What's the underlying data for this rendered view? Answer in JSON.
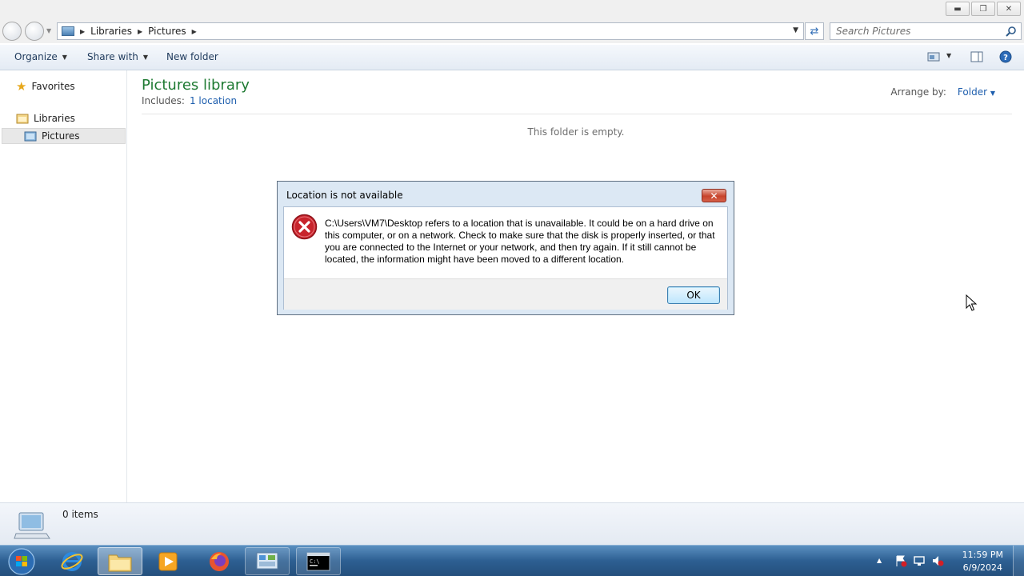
{
  "window": {
    "minimize_icon": "minimize-icon",
    "maximize_icon": "restore-icon",
    "close_icon": "close-icon"
  },
  "address": {
    "crumbs": [
      "Libraries",
      "Pictures"
    ],
    "search_placeholder": "Search Pictures"
  },
  "toolbar": {
    "organize": "Organize",
    "share_with": "Share with",
    "new_folder": "New folder"
  },
  "sidebar": {
    "favorites": "Favorites",
    "libraries": "Libraries",
    "pictures": "Pictures"
  },
  "main": {
    "title": "Pictures library",
    "includes_label": "Includes:",
    "includes_link": "1 location",
    "arrange_label": "Arrange by:",
    "arrange_value": "Folder",
    "empty_text": "This folder is empty."
  },
  "details": {
    "item_count": "0 items"
  },
  "dialog": {
    "title": "Location is not available",
    "message": "C:\\Users\\VM7\\Desktop refers to a location that is unavailable. It could be on a hard drive on this computer, or on a network. Check to make sure that the disk is properly inserted, or that you are connected to the Internet or your network, and then try again. If it still cannot be located, the information might have been moved to a different location.",
    "ok_label": "OK"
  },
  "taskbar": {
    "time": "11:59 PM",
    "date": "6/9/2024",
    "items": [
      "start-orb",
      "internet-explorer",
      "windows-explorer",
      "media-player",
      "firefox",
      "control-panel",
      "command-prompt"
    ]
  },
  "colors": {
    "title_green": "#1e7a32",
    "link_blue": "#1f5fae",
    "taskbar_blue": "#2d5f92"
  }
}
